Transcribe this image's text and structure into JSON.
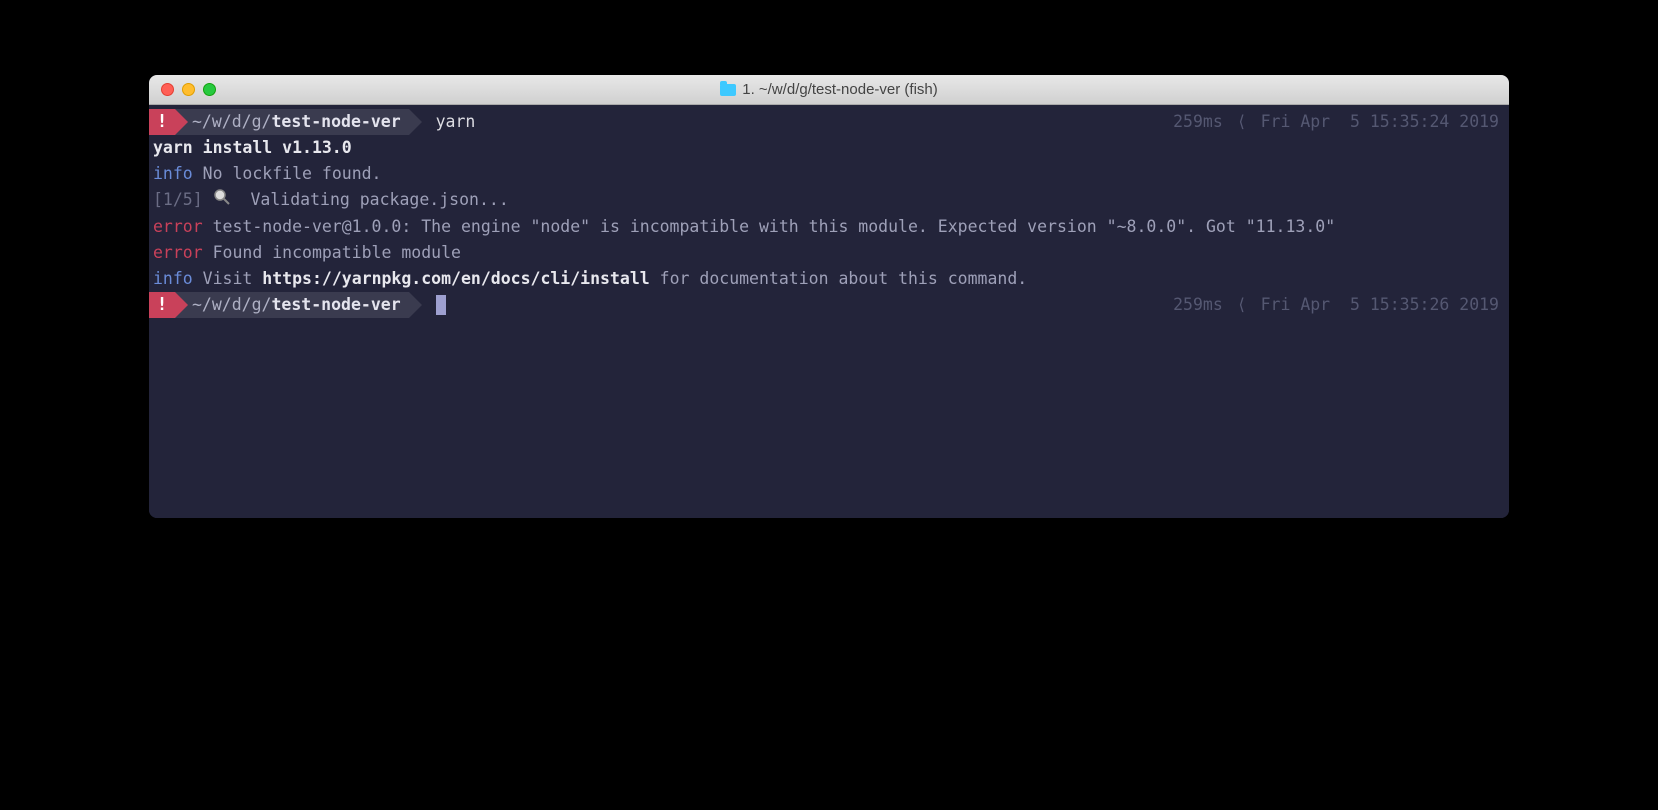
{
  "titlebar": {
    "title": "1. ~/w/d/g/test-node-ver (fish)"
  },
  "prompt1": {
    "badge": "!",
    "path_prefix": "~/w/d/g/",
    "path_dir": "test-node-ver",
    "command": "yarn",
    "duration": "259ms",
    "timestamp": "Fri Apr  5 15:35:24 2019"
  },
  "output": {
    "line1": "yarn install v1.13.0",
    "line2_tag": "info",
    "line2_msg": " No lockfile found.",
    "line3_bracket": "[1/5]",
    "line3_msg": "  Validating package.json...",
    "line4_tag": "error",
    "line4_msg": " test-node-ver@1.0.0: The engine \"node\" is incompatible with this module. Expected version \"~8.0.0\". Got \"11.13.0\"",
    "line5_tag": "error",
    "line5_msg": " Found incompatible module",
    "line6_tag": "info",
    "line6_pre": " Visit ",
    "line6_link": "https://yarnpkg.com/en/docs/cli/install",
    "line6_post": " for documentation about this command."
  },
  "prompt2": {
    "badge": "!",
    "path_prefix": "~/w/d/g/",
    "path_dir": "test-node-ver",
    "duration": "259ms",
    "timestamp": "Fri Apr  5 15:35:26 2019"
  }
}
